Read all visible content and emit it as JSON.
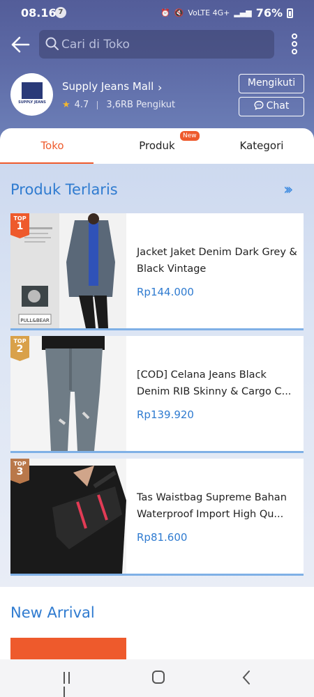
{
  "status_bar": {
    "time": "08.16",
    "notification_count": "7",
    "network": "VoLTE 4G+",
    "battery": "76%"
  },
  "header": {
    "search_placeholder": "Cari di Toko"
  },
  "store": {
    "name": "Supply Jeans Mall",
    "rating": "4.7",
    "followers": "3,6RB Pengikut",
    "logo_text": "SUPPLY JEANS",
    "follow_label": "Mengikuti",
    "chat_label": "Chat"
  },
  "tabs": [
    {
      "label": "Toko",
      "active": true
    },
    {
      "label": "Produk",
      "badge": "New"
    },
    {
      "label": "Kategori"
    }
  ],
  "best_sellers": {
    "title": "Produk Terlaris",
    "items": [
      {
        "rank_label": "TOP",
        "rank": "1",
        "title": "Jacket Jaket Denim Dark Grey & Black Vintage",
        "price": "Rp144.000"
      },
      {
        "rank_label": "TOP",
        "rank": "2",
        "title": "[COD] Celana Jeans Black Denim RIB Skinny & Cargo C...",
        "price": "Rp139.920"
      },
      {
        "rank_label": "TOP",
        "rank": "3",
        "title": "Tas Waistbag Supreme Bahan Waterproof Import High Qu...",
        "price": "Rp81.600"
      }
    ]
  },
  "new_arrival": {
    "title": "New Arrival"
  },
  "colors": {
    "accent": "#ee5a2c",
    "link_blue": "#2f7bd0",
    "header_bg": "#5d6aa6"
  }
}
